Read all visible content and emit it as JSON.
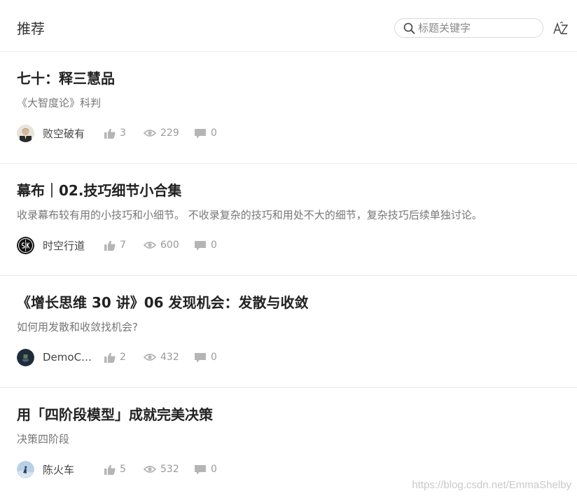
{
  "header": {
    "title": "推荐",
    "search_placeholder": "标题关键字",
    "sort_icon": "sort-az-icon"
  },
  "articles": [
    {
      "title": "七十：释三慧品",
      "description": "《大智度论》科判",
      "author": "败空破有",
      "likes": "3",
      "views": "229",
      "comments": "0"
    },
    {
      "title": "幕布｜02.技巧细节小合集",
      "description": "收录幕布较有用的小技巧和小细节。 不收录复杂的技巧和用处不大的细节，复杂技巧后续单独讨论。",
      "author": "时空行道",
      "likes": "7",
      "views": "600",
      "comments": "0"
    },
    {
      "title": "《增长思维 30 讲》06 发现机会：发散与收敛",
      "description": "如何用发散和收敛找机会?",
      "author": "DemoChen",
      "likes": "2",
      "views": "432",
      "comments": "0"
    },
    {
      "title": "用「四阶段模型」成就完美决策",
      "description": "决策四阶段",
      "author": "陈火车",
      "likes": "5",
      "views": "532",
      "comments": "0"
    }
  ],
  "watermark": "https://blog.csdn.net/EmmaShelby",
  "colors": {
    "icon_gray": "#b5b5b5",
    "divider": "#ececec"
  }
}
